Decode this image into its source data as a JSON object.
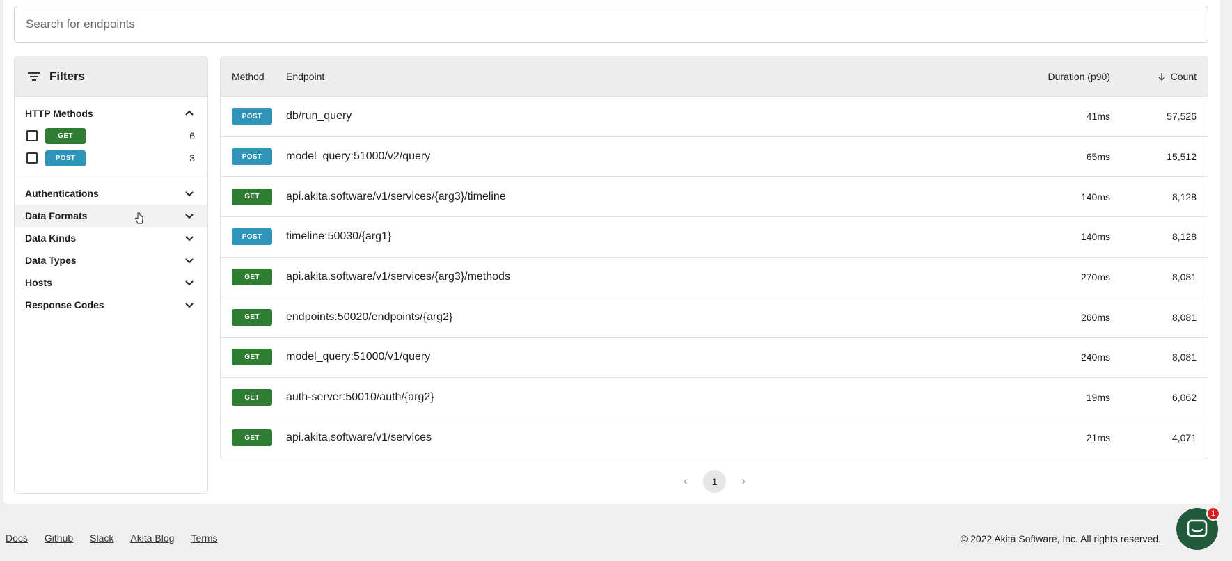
{
  "search": {
    "placeholder": "Search for endpoints",
    "value": ""
  },
  "filters": {
    "title": "Filters",
    "http_methods": {
      "label": "HTTP Methods",
      "options": [
        {
          "method": "GET",
          "count": "6",
          "checked": false
        },
        {
          "method": "POST",
          "count": "3",
          "checked": false
        }
      ]
    },
    "sections": [
      "Authentications",
      "Data Formats",
      "Data Kinds",
      "Data Types",
      "Hosts",
      "Response Codes"
    ]
  },
  "table": {
    "headers": {
      "method": "Method",
      "endpoint": "Endpoint",
      "duration": "Duration (p90)",
      "count": "Count"
    },
    "rows": [
      {
        "method": "POST",
        "endpoint": "db/run_query",
        "duration": "41ms",
        "count": "57,526"
      },
      {
        "method": "POST",
        "endpoint": "model_query:51000/v2/query",
        "duration": "65ms",
        "count": "15,512"
      },
      {
        "method": "GET",
        "endpoint": "api.akita.software/v1/services/{arg3}/timeline",
        "duration": "140ms",
        "count": "8,128"
      },
      {
        "method": "POST",
        "endpoint": "timeline:50030/{arg1}",
        "duration": "140ms",
        "count": "8,128"
      },
      {
        "method": "GET",
        "endpoint": "api.akita.software/v1/services/{arg3}/methods",
        "duration": "270ms",
        "count": "8,081"
      },
      {
        "method": "GET",
        "endpoint": "endpoints:50020/endpoints/{arg2}",
        "duration": "260ms",
        "count": "8,081"
      },
      {
        "method": "GET",
        "endpoint": "model_query:51000/v1/query",
        "duration": "240ms",
        "count": "8,081"
      },
      {
        "method": "GET",
        "endpoint": "auth-server:50010/auth/{arg2}",
        "duration": "19ms",
        "count": "6,062"
      },
      {
        "method": "GET",
        "endpoint": "api.akita.software/v1/services",
        "duration": "21ms",
        "count": "4,071"
      }
    ]
  },
  "pagination": {
    "current_page": "1",
    "prev_icon": "chevron-left-icon",
    "next_icon": "chevron-right-icon"
  },
  "footer": {
    "links": [
      "Docs",
      "Github",
      "Slack",
      "Akita Blog",
      "Terms"
    ],
    "copyright": "© 2022 Akita Software, Inc. All rights reserved."
  },
  "chat": {
    "notification_count": "1"
  },
  "colors": {
    "get_badge": "#2f7d32",
    "post_badge": "#2e94b8",
    "chat_button": "#1f5a3b",
    "notification": "#d71f22"
  }
}
